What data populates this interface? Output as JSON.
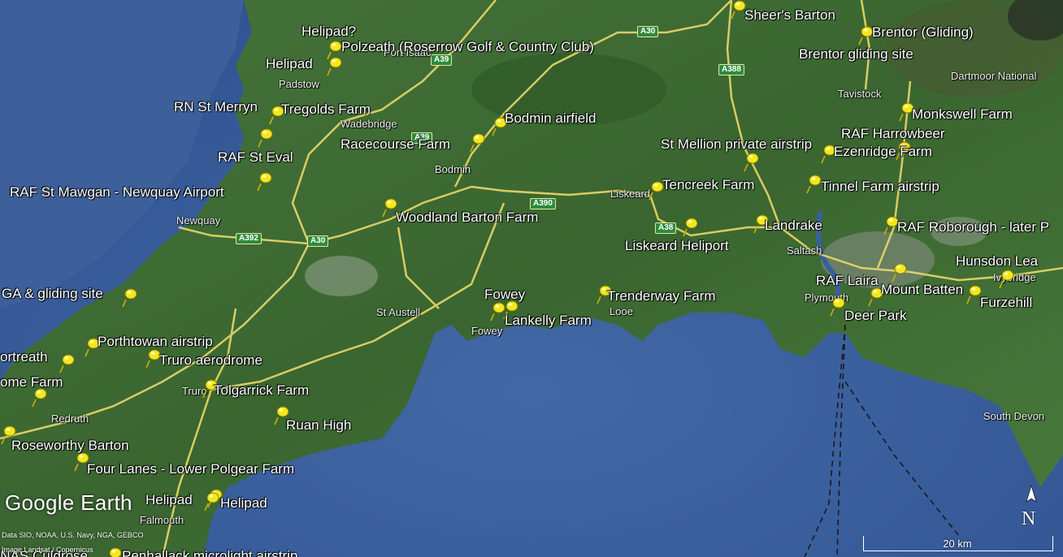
{
  "app": {
    "brand": "Google Earth",
    "credits_line1": "Data SIO, NOAA, U.S. Navy, NGA, GEBCO",
    "credits_line2": "Image Landsat / Copernicus",
    "compass_label": "N",
    "scale_label": "20 km"
  },
  "colors": {
    "sea": "#3a5f9e",
    "land": "#3e6b36",
    "road": "#e8d86a",
    "pin": "#f2e81e",
    "road_badge": "#2e8b3e"
  },
  "placemarks": [
    {
      "label": "Sheer's Barton"
    },
    {
      "label": "Brentor (Gliding)"
    },
    {
      "label": "Brentor gliding site"
    },
    {
      "label": "Helipad?"
    },
    {
      "label": "Polzeath (Roserrow Golf & Country Club)"
    },
    {
      "label": "Helipad"
    },
    {
      "label": "RN St Merryn"
    },
    {
      "label": "Tregolds Farm"
    },
    {
      "label": "Bodmin airfield"
    },
    {
      "label": "Monkswell Farm"
    },
    {
      "label": "RAF Harrowbeer"
    },
    {
      "label": "Racecourse Farm"
    },
    {
      "label": "St Mellion private airstrip"
    },
    {
      "label": "Ezenridge Farm"
    },
    {
      "label": "RAF St Eval"
    },
    {
      "label": "RAF St Mawgan - Newquay Airport"
    },
    {
      "label": "Tencreek Farm"
    },
    {
      "label": "Tinnel Farm airstrip"
    },
    {
      "label": "Woodland Barton Farm"
    },
    {
      "label": "Landrake"
    },
    {
      "label": "RAF Roborough - later P"
    },
    {
      "label": "Liskeard Heliport"
    },
    {
      "label": "Hunsdon Lea"
    },
    {
      "label": "RAF Laira"
    },
    {
      "label": "GA & gliding site"
    },
    {
      "label": "Fowey"
    },
    {
      "label": "Trenderway Farm"
    },
    {
      "label": "Mount Batten"
    },
    {
      "label": "Furzehill"
    },
    {
      "label": "Deer Park"
    },
    {
      "label": "Lankelly Farm"
    },
    {
      "label": "Porthtowan airstrip"
    },
    {
      "label": "ortreath"
    },
    {
      "label": "Truro aerodrome"
    },
    {
      "label": "ome Farm"
    },
    {
      "label": "Tolgarrick Farm"
    },
    {
      "label": "Ruan High"
    },
    {
      "label": "Roseworthy Barton"
    },
    {
      "label": "Four Lanes - Lower Polgear Farm"
    },
    {
      "label": "Helipad"
    },
    {
      "label": "Helipad"
    },
    {
      "label": "RNAS Culdrose"
    },
    {
      "label": "Penhallack microlight airstrip"
    }
  ],
  "towns": [
    {
      "label": "Port Isaac"
    },
    {
      "label": "Padstow"
    },
    {
      "label": "Wadebridge"
    },
    {
      "label": "Bodmin"
    },
    {
      "label": "Newquay"
    },
    {
      "label": "Liskeard"
    },
    {
      "label": "Tavistock"
    },
    {
      "label": "Dartmoor National"
    },
    {
      "label": "Saltash"
    },
    {
      "label": "Plymouth"
    },
    {
      "label": "Ivybridge"
    },
    {
      "label": "St Austell"
    },
    {
      "label": "Fowey"
    },
    {
      "label": "Looe"
    },
    {
      "label": "Truro"
    },
    {
      "label": "Redruth"
    },
    {
      "label": "Falmouth"
    },
    {
      "label": "South Devon"
    }
  ],
  "roads": [
    {
      "label": "A30"
    },
    {
      "label": "A39"
    },
    {
      "label": "A388"
    },
    {
      "label": "A390"
    },
    {
      "label": "A38"
    },
    {
      "label": "A392"
    },
    {
      "label": "A30"
    },
    {
      "label": "A39"
    }
  ]
}
